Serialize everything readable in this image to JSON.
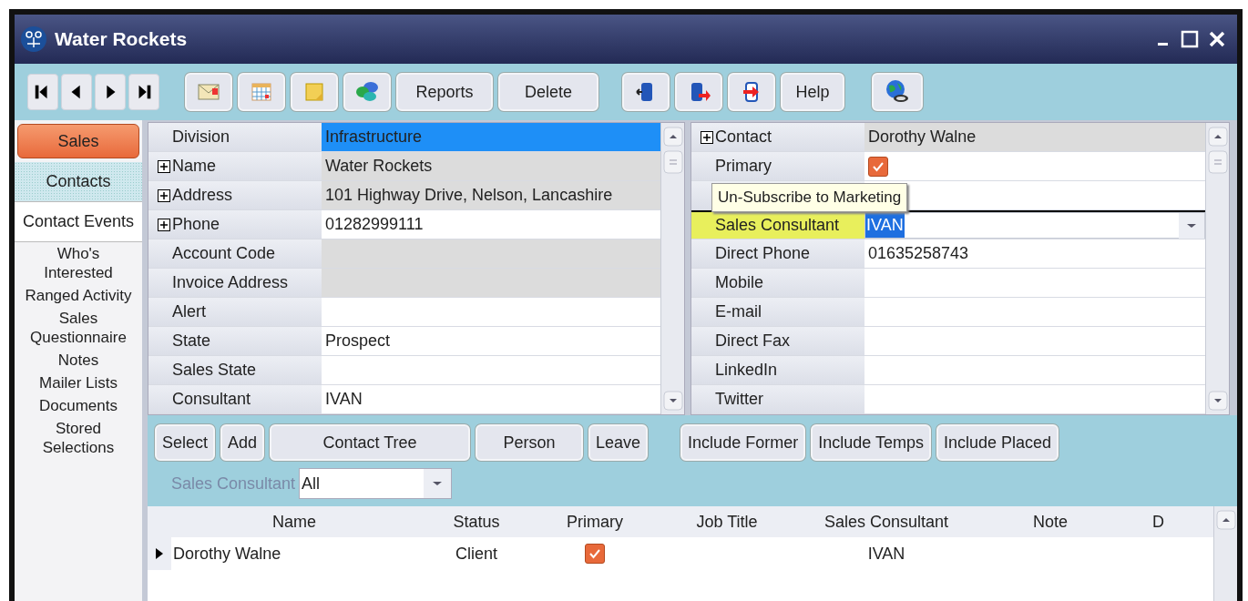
{
  "window": {
    "title": "Water Rockets"
  },
  "toolbar": {
    "text_buttons": [
      "Reports",
      "Delete"
    ],
    "help": "Help"
  },
  "sidebar": {
    "module_button": {
      "label": "Sales",
      "selected": true
    },
    "tabs": [
      {
        "label": "Contacts",
        "selected": true
      },
      {
        "label": "Contact Events",
        "selected": false
      }
    ],
    "links": [
      "Who's Interested",
      "Ranged Activity",
      "Sales Questionnaire",
      "Notes",
      "Mailer Lists",
      "Documents",
      "Stored Selections"
    ]
  },
  "company_grid": [
    {
      "label": "Division",
      "value": "Infrastructure",
      "expandable": false,
      "kind": "selected"
    },
    {
      "label": "Name",
      "value": "Water Rockets",
      "expandable": true,
      "kind": "readonly"
    },
    {
      "label": "Address",
      "value": "101 Highway Drive, Nelson, Lancashire",
      "expandable": true,
      "kind": "readonly"
    },
    {
      "label": "Phone",
      "value": "01282999111",
      "expandable": true,
      "kind": "plain"
    },
    {
      "label": "Account Code",
      "expandable": false,
      "kind": "readonly"
    },
    {
      "label": "Invoice Address",
      "expandable": false,
      "kind": "readonly"
    },
    {
      "label": "Alert",
      "expandable": false,
      "kind": "plain"
    },
    {
      "label": "State",
      "value": "Prospect",
      "expandable": false,
      "kind": "plain"
    },
    {
      "label": "Sales State",
      "expandable": false,
      "kind": "plain"
    },
    {
      "label": "Consultant",
      "value": "IVAN",
      "expandable": false,
      "kind": "plain"
    }
  ],
  "contact_grid": [
    {
      "kind": "readonly",
      "label": "Contact",
      "value": "Dorothy Walne",
      "expandable": true,
      "highlighted": false
    },
    {
      "kind": "checkbox",
      "label": "Primary",
      "checked": true,
      "expandable": false,
      "highlighted": false
    },
    {
      "kind": "blank",
      "expandable": false,
      "highlighted": false
    },
    {
      "kind": "dropdown",
      "label": "Sales Consultant",
      "value": "IVAN",
      "expandable": false,
      "highlighted": true
    },
    {
      "kind": "plain",
      "label": "Direct Phone",
      "value": "01635258743",
      "expandable": false,
      "highlighted": false
    },
    {
      "kind": "plain",
      "label": "Mobile",
      "expandable": false,
      "highlighted": false
    },
    {
      "kind": "plain",
      "label": "E-mail",
      "expandable": false,
      "highlighted": false
    },
    {
      "kind": "plain",
      "label": "Direct Fax",
      "expandable": false,
      "highlighted": false
    },
    {
      "kind": "plain",
      "label": "LinkedIn",
      "expandable": false,
      "highlighted": false
    },
    {
      "kind": "plain",
      "label": "Twitter",
      "expandable": false,
      "highlighted": false
    }
  ],
  "tooltip": "Un-Subscribe to Marketing",
  "contacts_panel": {
    "buttons_left": [
      "Select",
      "Add",
      "Contact Tree",
      "Person",
      "Leave"
    ],
    "buttons_right": [
      "Include Former",
      "Include Temps",
      "Include Placed"
    ],
    "filter": {
      "label": "Sales Consultant",
      "value": "All"
    },
    "table": {
      "columns": [
        "Name",
        "Status",
        "Primary",
        "Job Title",
        "Sales Consultant",
        "Note",
        "D"
      ],
      "rows": [
        {
          "current": true,
          "name": "Dorothy Walne",
          "status": "Client",
          "primary": true,
          "job_title": "",
          "sales_consultant": "IVAN",
          "note": ""
        }
      ]
    }
  }
}
